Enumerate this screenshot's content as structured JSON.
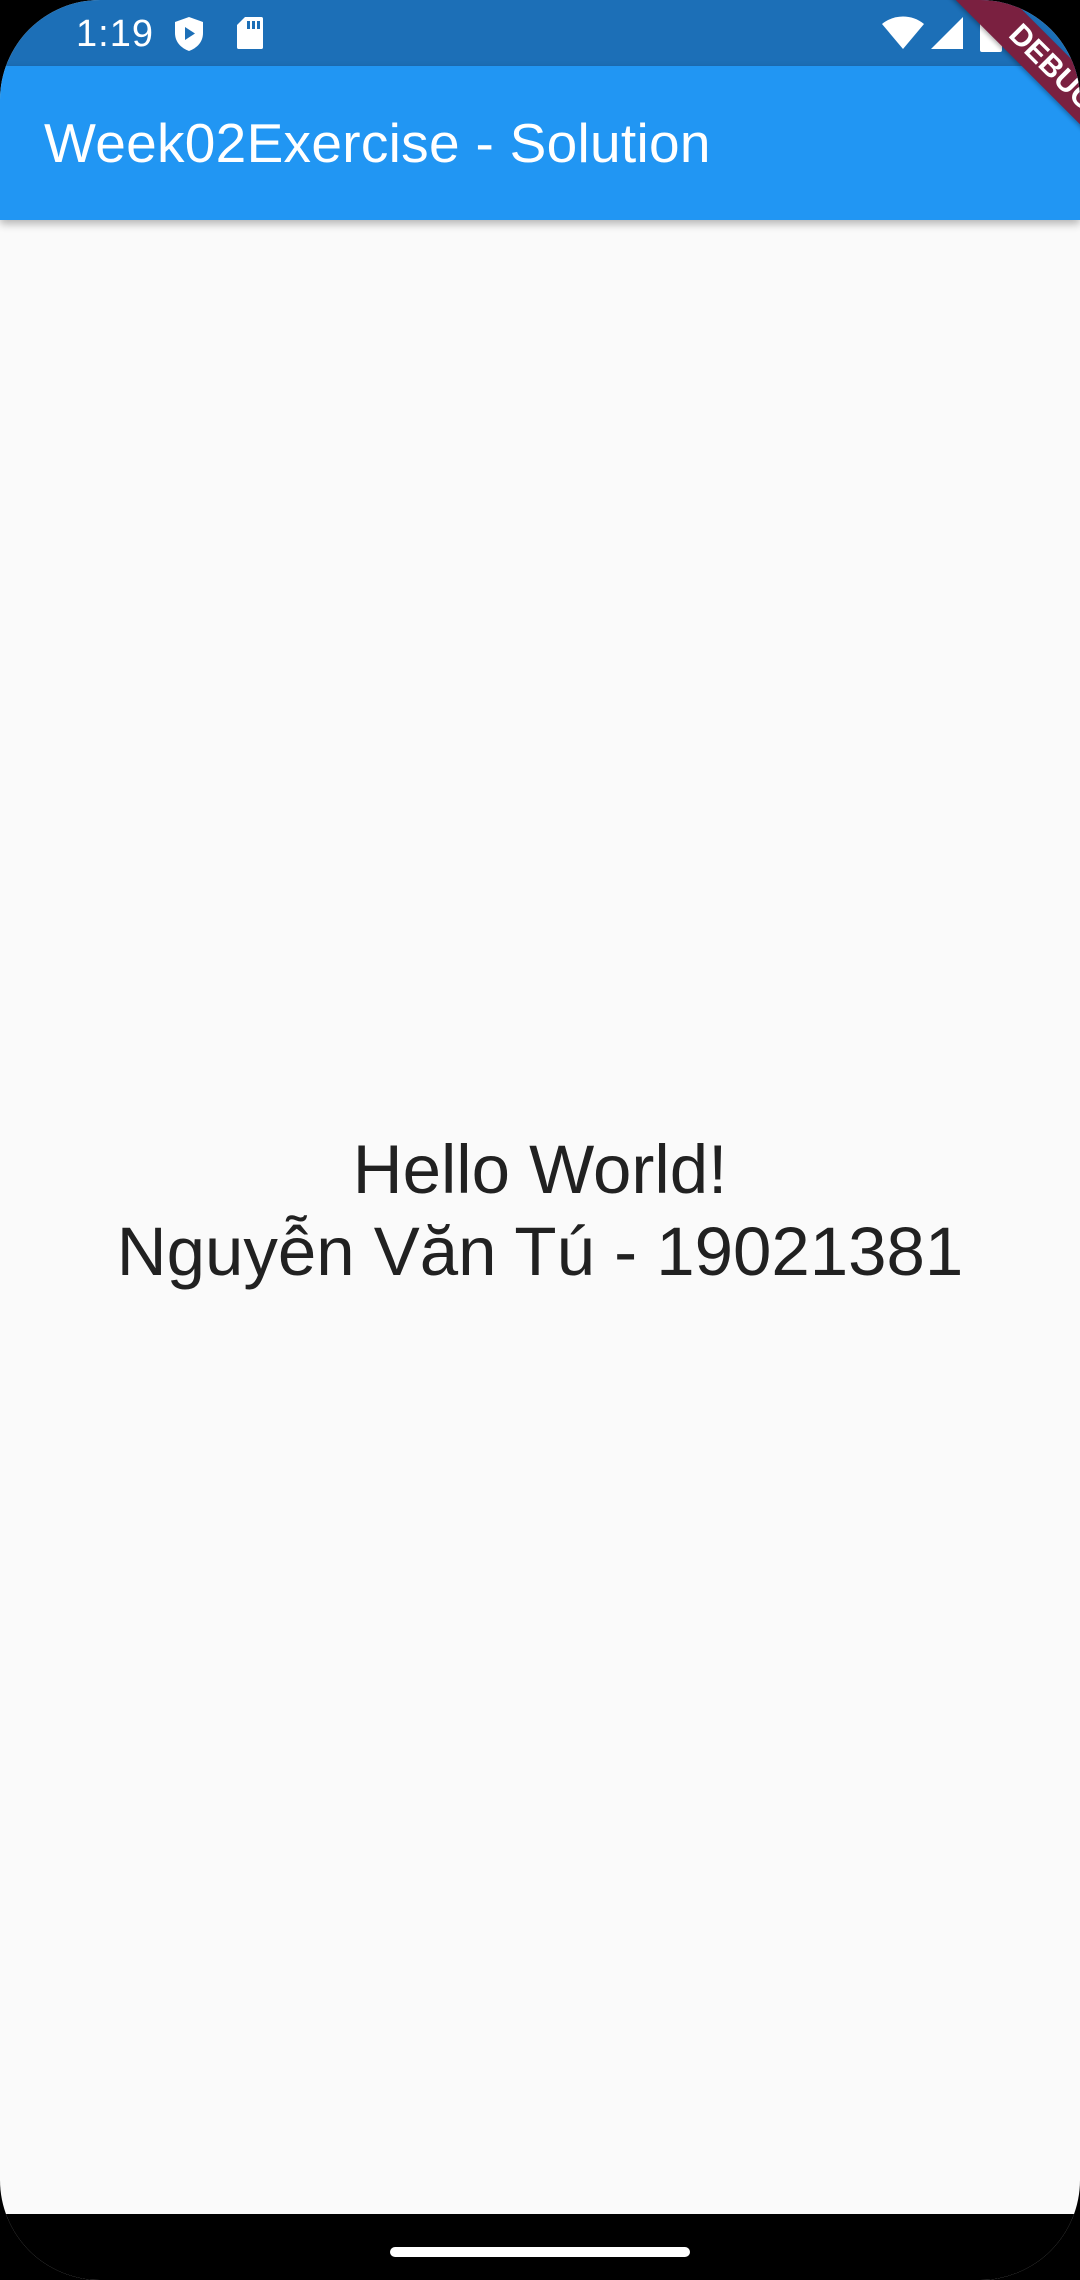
{
  "status_bar": {
    "time": "1:19",
    "left_icons": [
      "play-protect-icon",
      "sd-card-icon"
    ],
    "right_icons": [
      "wifi-icon",
      "cellular-signal-icon",
      "battery-icon"
    ]
  },
  "app_bar": {
    "title": "Week02Exercise - Solution",
    "color": "#2196f3"
  },
  "debug_banner": {
    "label": "DEBUG"
  },
  "body": {
    "line1": "Hello World!",
    "line2": "Nguyễn Văn Tú - 19021381"
  },
  "nav_bar": {
    "handle": "gesture-handle"
  }
}
